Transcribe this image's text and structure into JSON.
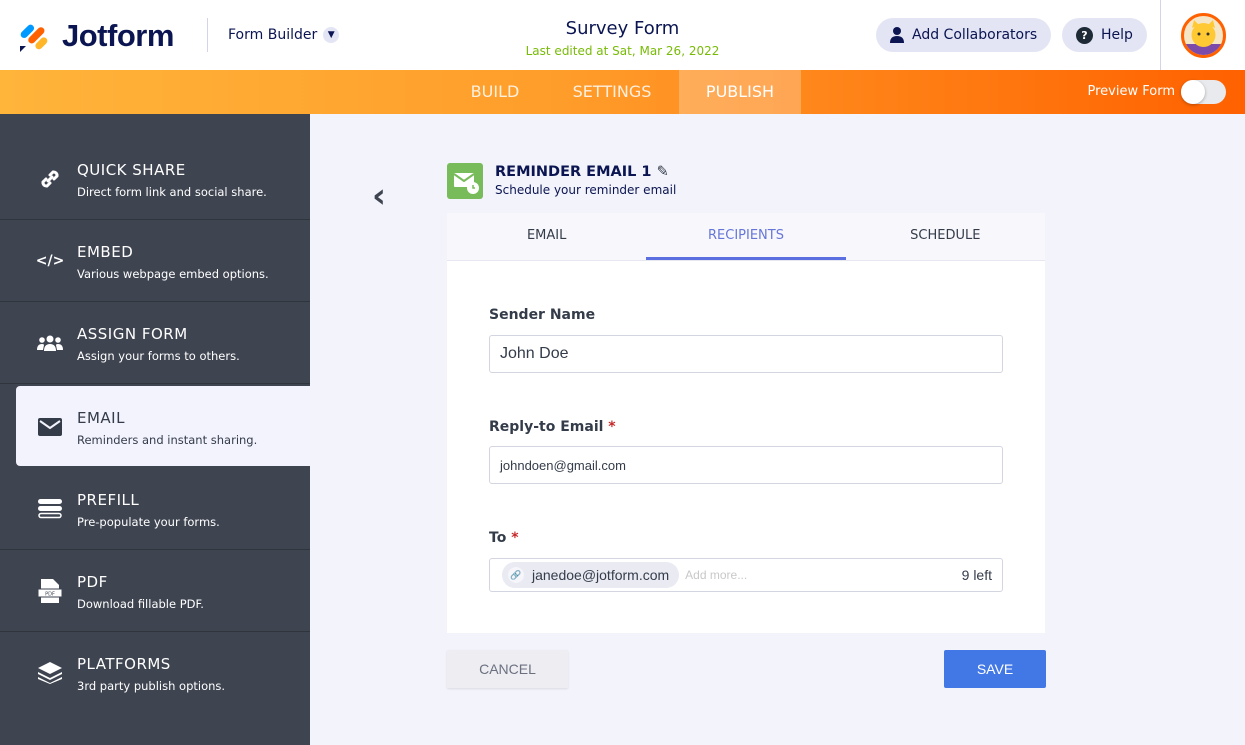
{
  "header": {
    "brand": "Jotform",
    "app_switch": "Form Builder",
    "form_title": "Survey Form",
    "last_edited": "Last edited at Sat, Mar 26, 2022",
    "add_collaborators": "Add Collaborators",
    "help": "Help"
  },
  "nav": {
    "tabs": [
      "BUILD",
      "SETTINGS",
      "PUBLISH"
    ],
    "active": "PUBLISH",
    "preview_label": "Preview Form",
    "preview_on": false
  },
  "sidebar": {
    "items": [
      {
        "name": "QUICK SHARE",
        "desc": "Direct form link and social share.",
        "icon": "link-icon"
      },
      {
        "name": "EMBED",
        "desc": "Various webpage embed options.",
        "icon": "code-icon"
      },
      {
        "name": "ASSIGN FORM",
        "desc": "Assign your forms to others.",
        "icon": "users-icon"
      },
      {
        "name": "EMAIL",
        "desc": "Reminders and instant sharing.",
        "icon": "envelope-icon"
      },
      {
        "name": "PREFILL",
        "desc": "Pre-populate your forms.",
        "icon": "prefill-icon"
      },
      {
        "name": "PDF",
        "desc": "Download fillable PDF.",
        "icon": "pdf-icon",
        "icon_text": "PDF"
      },
      {
        "name": "PLATFORMS",
        "desc": "3rd party publish options.",
        "icon": "layers-icon"
      }
    ],
    "active": "EMAIL"
  },
  "editor": {
    "title": "REMINDER EMAIL 1",
    "subtitle": "Schedule your reminder email",
    "tabs": [
      "EMAIL",
      "RECIPIENTS",
      "SCHEDULE"
    ],
    "active_tab": "RECIPIENTS",
    "sender_label": "Sender Name",
    "sender_value": "John Doe",
    "reply_label": "Reply-to Email",
    "reply_value": "johndoen@gmail.com",
    "to_label": "To",
    "to_chip": "janedoe@jotform.com",
    "to_placeholder": "Add more...",
    "to_remaining": "9 left",
    "required_mark": "*",
    "cancel": "CANCEL",
    "save": "SAVE"
  },
  "colors": {
    "accent": "#ff6100",
    "save": "#4277e6",
    "active_tab": "#5c6fe0"
  }
}
